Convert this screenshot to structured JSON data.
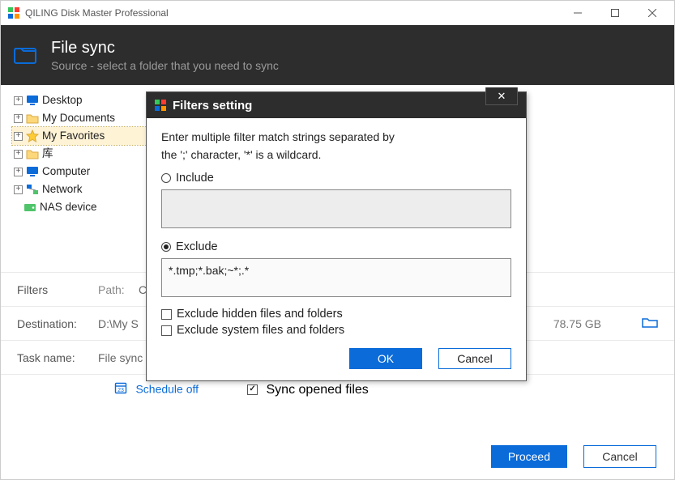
{
  "titlebar": {
    "app_name": "QILING Disk Master Professional"
  },
  "header": {
    "title": "File sync",
    "subtitle": "Source - select a folder that you need to sync"
  },
  "tree": {
    "items": [
      {
        "label": "Desktop",
        "icon": "monitor"
      },
      {
        "label": "My Documents",
        "icon": "folder"
      },
      {
        "label": "My Favorites",
        "icon": "star",
        "selected": true
      },
      {
        "label": "库",
        "icon": "folder"
      },
      {
        "label": "Computer",
        "icon": "monitor"
      },
      {
        "label": "Network",
        "icon": "network"
      },
      {
        "label": "NAS device",
        "icon": "nas"
      }
    ]
  },
  "rows": {
    "filters_label": "Filters",
    "path_label": "Path:",
    "path_value": "C:\\U",
    "dest_label": "Destination:",
    "dest_value": "D:\\My S",
    "dest_free": "78.75 GB",
    "task_label": "Task name:",
    "task_value": "File sync"
  },
  "schedule": {
    "schedule_label": "Schedule off",
    "sync_opened_label": "Sync opened files",
    "sync_opened_checked": true
  },
  "main_buttons": {
    "proceed": "Proceed",
    "cancel": "Cancel"
  },
  "dialog": {
    "title": "Filters setting",
    "intro1": "Enter multiple filter match strings separated by",
    "intro2": "the ';' character, '*' is a wildcard.",
    "include_label": "Include",
    "include_value": "",
    "exclude_label": "Exclude",
    "exclude_value": "*.tmp;*.bak;~*;.*",
    "chk_hidden": "Exclude hidden files and folders",
    "chk_system": "Exclude system files and folders",
    "ok": "OK",
    "cancel": "Cancel"
  }
}
